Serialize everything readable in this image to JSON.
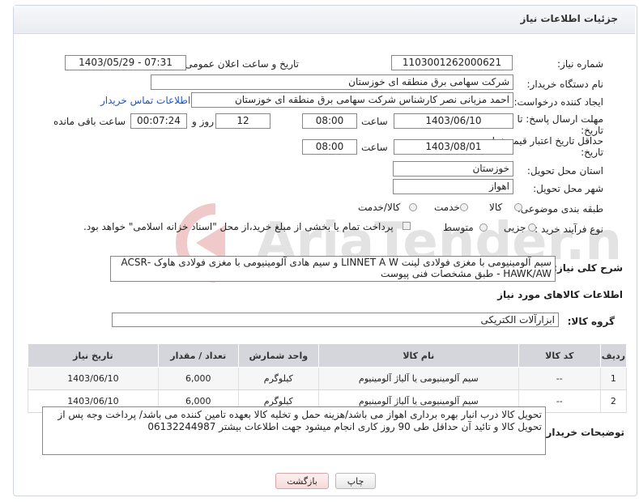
{
  "header": {
    "title": "جزئیات اطلاعات نیاز"
  },
  "form": {
    "need_number_label": "شماره نیاز:",
    "need_number": "1103001262000621",
    "announce_label": "تاریخ و ساعت اعلان عمومی:",
    "announce_value": "1403/05/29 - 07:31",
    "buyer_label": "نام دستگاه خریدار:",
    "buyer_value": "شرکت سهامی برق منطقه ای خوزستان",
    "creator_label": "ایجاد کننده درخواست:",
    "creator_value": "احمد مزبانی نصر کارشناس شرکت سهامی برق منطقه ای خوزستان",
    "contact_link": "اطلاعات تماس خریدار",
    "deadline_label_1": "مهلت ارسال پاسخ: تا",
    "deadline_label_2": "تاریخ:",
    "deadline_date": "1403/06/10",
    "time_label": "ساعت",
    "deadline_time": "08:00",
    "days_value": "12",
    "days_label": "روز و",
    "remaining_time": "00:07:24",
    "remaining_label": "ساعت باقی مانده",
    "validity_label_1": "حداقل تاریخ اعتبار قیمت: تا",
    "validity_label_2": "تاریخ:",
    "validity_date": "1403/08/01",
    "validity_time": "08:00",
    "province_label": "استان محل تحویل:",
    "province_value": "خوزستان",
    "city_label": "شهر محل تحویل:",
    "city_value": "اهواز",
    "category_label": "طبقه بندی موضوعی:",
    "category_options": [
      "کالا",
      "خدمت",
      "کالا/خدمت"
    ],
    "process_label": "نوع فرآیند خرید :",
    "process_options": [
      "جزیی",
      "متوسط"
    ],
    "process_note": "پرداخت تمام یا بخشی از مبلغ خرید،از محل \"اسناد خزانه اسلامی\" خواهد بود.",
    "summary_label": "شرح کلی نیاز:",
    "summary_line1": "سیم آلومینیومی با مغزی فولادی لینت LINNET A W و سیم هادی آلومینیومی با مغزی فولادی هاوک -ACSR",
    "summary_line2": "HAWK/AW - طبق مشخصات فنی پیوست"
  },
  "goods": {
    "section_title": "اطلاعات کالاهای مورد نیاز",
    "group_label": "گروه کالا:",
    "group_value": "ابزارآلات الکتریکی",
    "columns": [
      "ردیف",
      "کد کالا",
      "نام کالا",
      "واحد شمارش",
      "تعداد / مقدار",
      "تاریخ نیاز"
    ],
    "rows": [
      {
        "idx": "1",
        "code": "--",
        "name": "سیم آلومینیومی یا آلیاژ آلومینیوم",
        "unit": "کیلوگرم",
        "qty": "6,000",
        "date": "1403/06/10"
      },
      {
        "idx": "2",
        "code": "--",
        "name": "سیم آلومینیومی یا آلیاژ آلومینیوم",
        "unit": "کیلوگرم",
        "qty": "6,000",
        "date": "1403/06/10"
      }
    ]
  },
  "buyer_notes": {
    "label": "توضیحات خریدار:",
    "line1": "تحویل کالا درب انبار بهره برداری اهواز می باشد/هزینه حمل و تخلیه کالا بعهده تامین کننده می باشد/ پرداخت وجه پس از",
    "line2": "تحویل کالا و تائید آن حداقل طی 90 روز کاری انجام میشود  جهت اطلاعات بیشتر 06132244987"
  },
  "buttons": {
    "print": "چاپ",
    "back": "بازگشت"
  },
  "watermark": {
    "text": "AriaTender.net"
  },
  "colors": {
    "link": "#1a55c4",
    "table_header": "#d4d6db",
    "watermark": "#e3e3e3",
    "watermark_icon": "#f0caca"
  }
}
